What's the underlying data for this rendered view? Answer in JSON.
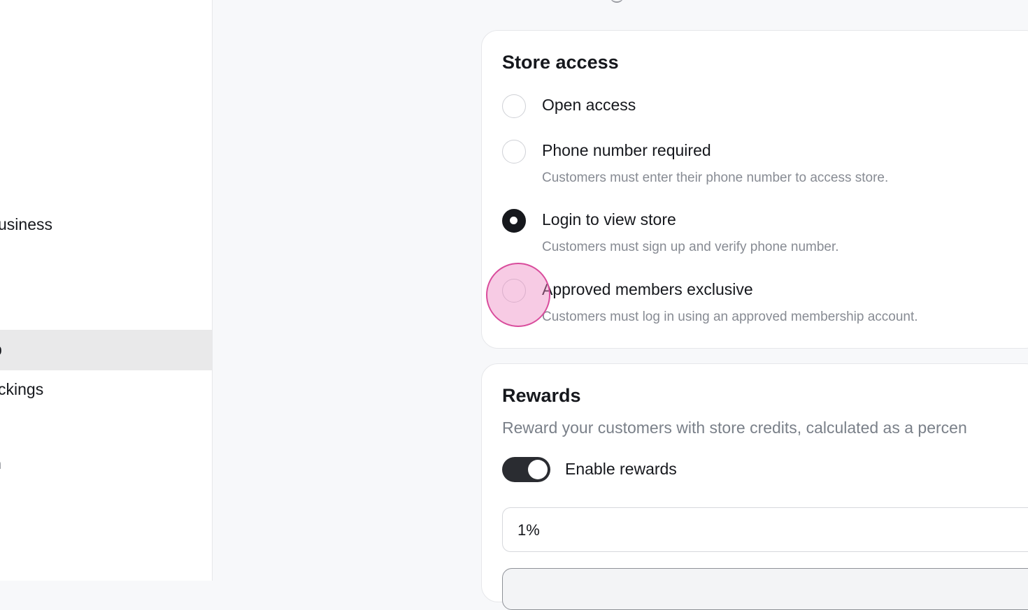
{
  "sidebar": {
    "items": [
      {
        "label": "usiness"
      },
      {
        "label": "p"
      },
      {
        "label": "ckings"
      },
      {
        "label": "n"
      }
    ]
  },
  "store_access": {
    "title": "Store access",
    "options": [
      {
        "label": "Open access",
        "description": "",
        "selected": false
      },
      {
        "label": "Phone number required",
        "description": "Customers must enter their phone number to access store.",
        "selected": false
      },
      {
        "label": "Login to view store",
        "description": "Customers must sign up and verify phone number.",
        "selected": true
      },
      {
        "label": "Approved members exclusive",
        "description": "Customers must log in using an approved membership account.",
        "selected": false
      }
    ]
  },
  "rewards": {
    "title": "Rewards",
    "description": "Reward your customers with store credits, calculated as a percen",
    "toggle_label": "Enable rewards",
    "toggle_on": true,
    "percent_value": "1%"
  },
  "colors": {
    "accent": "#16181d",
    "click_marker": "#d94c9c",
    "muted_text": "#878b93"
  }
}
